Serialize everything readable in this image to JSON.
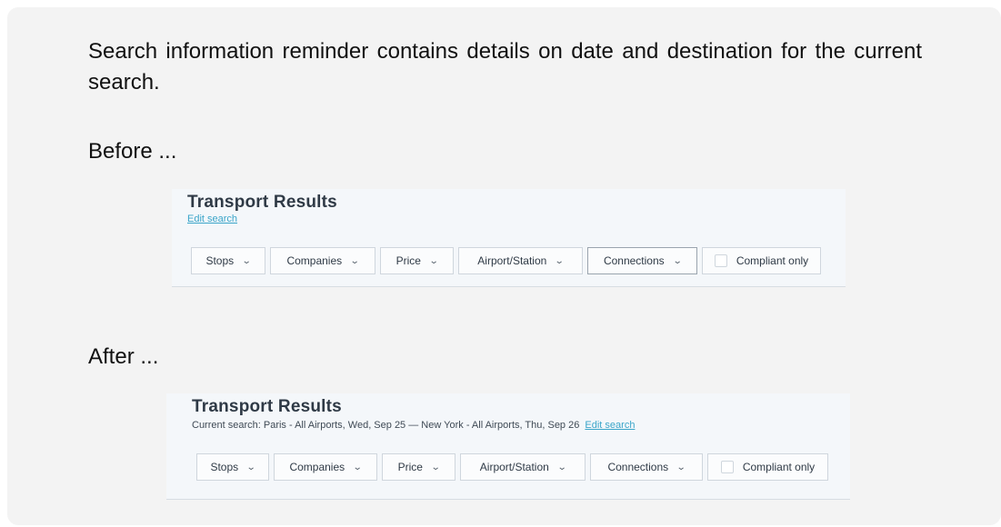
{
  "description": "Search information reminder contains details on date and destination for the current search.",
  "before_label": "Before ...",
  "after_label": "After ...",
  "before": {
    "title": "Transport Results",
    "edit_link": "Edit search",
    "filters": [
      "Stops",
      "Companies",
      "Price",
      "Airport/Station",
      "Connections"
    ],
    "compliant_label": "Compliant only"
  },
  "after": {
    "title": "Transport Results",
    "current_search": "Current search: Paris - All Airports, Wed, Sep 25 — New York - All Airports, Thu, Sep 26",
    "edit_link": "Edit search",
    "filters": [
      "Stops",
      "Companies",
      "Price",
      "Airport/Station",
      "Connections"
    ],
    "compliant_label": "Compliant only"
  },
  "icons": {
    "dropdown": "chevron-down-icon",
    "checkbox": "checkbox-icon"
  },
  "colors": {
    "link": "#3aa5c9",
    "panel_bg": "#f4f7fa",
    "card_bg": "#f3f3f3"
  }
}
